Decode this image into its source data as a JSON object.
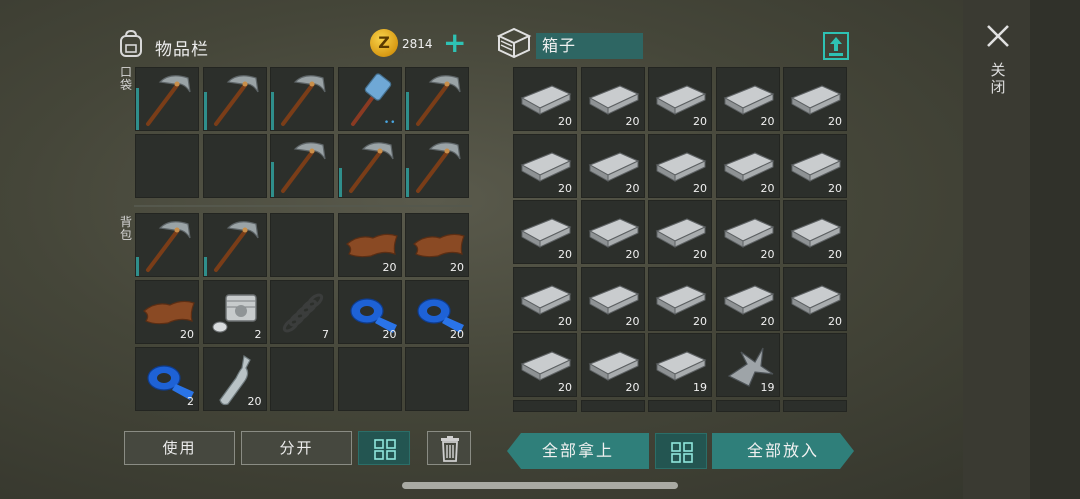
{
  "inventory": {
    "title": "物品栏",
    "coins": "2814",
    "coin_symbol": "Z",
    "plus_label": "+",
    "pocket_label": "口袋",
    "backpack_label": "背包",
    "pocket_slots": [
      {
        "item": "pickaxe",
        "qty": "",
        "durability": 0.65
      },
      {
        "item": "pickaxe",
        "qty": "",
        "durability": 0.6
      },
      {
        "item": "pickaxe",
        "qty": "",
        "durability": 0.6
      },
      {
        "item": "hammer",
        "qty": "",
        "durability": 0.0,
        "dots": "••"
      },
      {
        "item": "pickaxe",
        "qty": "",
        "durability": 0.6
      },
      {
        "item": "empty",
        "qty": ""
      },
      {
        "item": "empty",
        "qty": ""
      },
      {
        "item": "pickaxe",
        "qty": "",
        "durability": 0.55
      },
      {
        "item": "pickaxe",
        "qty": "",
        "durability": 0.45
      },
      {
        "item": "pickaxe",
        "qty": "",
        "durability": 0.45
      }
    ],
    "backpack_slots": [
      {
        "item": "pickaxe",
        "qty": "",
        "durability": 0.3
      },
      {
        "item": "pickaxe",
        "qty": "",
        "durability": 0.3
      },
      {
        "item": "empty",
        "qty": ""
      },
      {
        "item": "leather",
        "qty": "20"
      },
      {
        "item": "leather",
        "qty": "20"
      },
      {
        "item": "leather",
        "qty": "20"
      },
      {
        "item": "engine-part",
        "qty": "2"
      },
      {
        "item": "spring",
        "qty": "7"
      },
      {
        "item": "tape",
        "qty": "20"
      },
      {
        "item": "tape",
        "qty": "20"
      },
      {
        "item": "tape",
        "qty": "2"
      },
      {
        "item": "bottle",
        "qty": "20"
      },
      {
        "item": "empty",
        "qty": ""
      },
      {
        "item": "empty",
        "qty": ""
      },
      {
        "item": "empty",
        "qty": ""
      }
    ],
    "buttons": {
      "use": "使用",
      "split": "分开"
    }
  },
  "box": {
    "name": "箱子",
    "slots": [
      {
        "item": "metal-bar",
        "qty": "20"
      },
      {
        "item": "metal-bar",
        "qty": "20"
      },
      {
        "item": "metal-bar",
        "qty": "20"
      },
      {
        "item": "metal-bar",
        "qty": "20"
      },
      {
        "item": "metal-bar",
        "qty": "20"
      },
      {
        "item": "metal-bar",
        "qty": "20"
      },
      {
        "item": "metal-bar",
        "qty": "20"
      },
      {
        "item": "metal-bar",
        "qty": "20"
      },
      {
        "item": "metal-bar",
        "qty": "20"
      },
      {
        "item": "metal-bar",
        "qty": "20"
      },
      {
        "item": "metal-bar",
        "qty": "20"
      },
      {
        "item": "metal-bar",
        "qty": "20"
      },
      {
        "item": "metal-bar",
        "qty": "20"
      },
      {
        "item": "metal-bar",
        "qty": "20"
      },
      {
        "item": "metal-bar",
        "qty": "20"
      },
      {
        "item": "metal-bar",
        "qty": "20"
      },
      {
        "item": "metal-bar",
        "qty": "20"
      },
      {
        "item": "metal-bar",
        "qty": "20"
      },
      {
        "item": "metal-bar",
        "qty": "20"
      },
      {
        "item": "metal-bar",
        "qty": "20"
      },
      {
        "item": "metal-bar",
        "qty": "20"
      },
      {
        "item": "metal-bar",
        "qty": "20"
      },
      {
        "item": "metal-bar",
        "qty": "19"
      },
      {
        "item": "metal-scrap",
        "qty": "19"
      },
      {
        "item": "empty",
        "qty": ""
      }
    ],
    "buttons": {
      "take_all": "全部拿上",
      "put_all": "全部放入"
    }
  },
  "close_label": "关闭",
  "colors": {
    "accent": "#2f7f7a",
    "durability": "#2f8f8c",
    "plus": "#2ec2b4"
  }
}
